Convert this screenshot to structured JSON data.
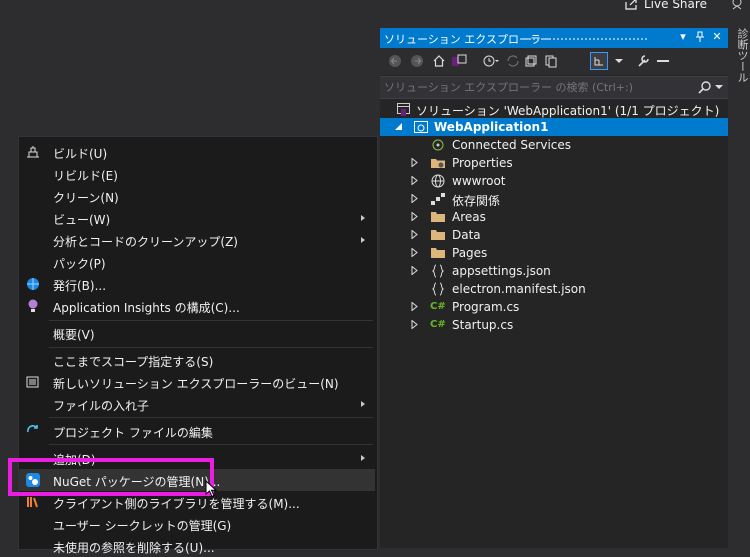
{
  "topbar": {
    "live_share": "Live Share"
  },
  "right_tab": {
    "label": "診断ツール"
  },
  "solution_explorer": {
    "title": "ソリューション エクスプローラー",
    "title_controls": {
      "dropdown": "▼",
      "pin": "⊿",
      "close": "✕"
    },
    "search_placeholder": "ソリューション エクスプローラー の検索 (Ctrl+:)",
    "solution_label": "ソリューション 'WebApplication1' (1/1 プロジェクト)",
    "project_label": "WebApplication1",
    "items": [
      {
        "label": "Connected Services",
        "icon": "connected-services-icon",
        "expandable": false
      },
      {
        "label": "Properties",
        "icon": "properties-folder-icon",
        "expandable": true
      },
      {
        "label": "wwwroot",
        "icon": "globe-icon",
        "expandable": true
      },
      {
        "label": "依存関係",
        "icon": "dependencies-icon",
        "expandable": true
      },
      {
        "label": "Areas",
        "icon": "folder-icon",
        "expandable": true
      },
      {
        "label": "Data",
        "icon": "folder-icon",
        "expandable": true
      },
      {
        "label": "Pages",
        "icon": "folder-icon",
        "expandable": true
      },
      {
        "label": "appsettings.json",
        "icon": "json-file-icon",
        "expandable": true
      },
      {
        "label": "electron.manifest.json",
        "icon": "json-file-icon",
        "expandable": false
      },
      {
        "label": "Program.cs",
        "icon": "csharp-file-icon",
        "expandable": true
      },
      {
        "label": "Startup.cs",
        "icon": "csharp-file-icon",
        "expandable": true
      }
    ],
    "colors": {
      "accent": "#007acc",
      "folder": "#dcb67a",
      "csharp": "#68b723"
    }
  },
  "context_menu": {
    "items": [
      {
        "label": "ビルド(U)",
        "icon": "build-icon",
        "submenu": false
      },
      {
        "label": "リビルド(E)",
        "icon": "",
        "submenu": false
      },
      {
        "label": "クリーン(N)",
        "icon": "",
        "submenu": false
      },
      {
        "label": "ビュー(W)",
        "icon": "",
        "submenu": true
      },
      {
        "label": "分析とコードのクリーンアップ(Z)",
        "icon": "",
        "submenu": true
      },
      {
        "label": "パック(P)",
        "icon": "",
        "submenu": false
      },
      {
        "label": "発行(B)...",
        "icon": "publish-globe-icon",
        "submenu": false
      },
      {
        "label": "Application Insights の構成(C)...",
        "icon": "app-insights-icon",
        "submenu": false
      },
      {
        "label": "概要(V)",
        "icon": "",
        "submenu": false
      },
      {
        "label": "ここまでスコープ指定する(S)",
        "icon": "",
        "submenu": false
      },
      {
        "label": "新しいソリューション エクスプローラーのビュー(N)",
        "icon": "new-view-icon",
        "submenu": false
      },
      {
        "label": "ファイルの入れ子",
        "icon": "",
        "submenu": true
      },
      {
        "label": "プロジェクト ファイルの編集",
        "icon": "edit-project-icon",
        "submenu": false
      },
      {
        "label": "追加(D)",
        "icon": "",
        "submenu": true
      },
      {
        "label": "NuGet パッケージの管理(N)...",
        "icon": "nuget-icon",
        "submenu": false
      },
      {
        "label": "クライアント側のライブラリを管理する(M)...",
        "icon": "client-library-icon",
        "submenu": false
      },
      {
        "label": "ユーザー シークレットの管理(G)",
        "icon": "",
        "submenu": false
      },
      {
        "label": "未使用の参照を削除する(U)...",
        "icon": "",
        "submenu": false
      }
    ],
    "highlighted_item": "NuGet パッケージの管理(N)...",
    "highlight_color": "#e91ee0"
  }
}
